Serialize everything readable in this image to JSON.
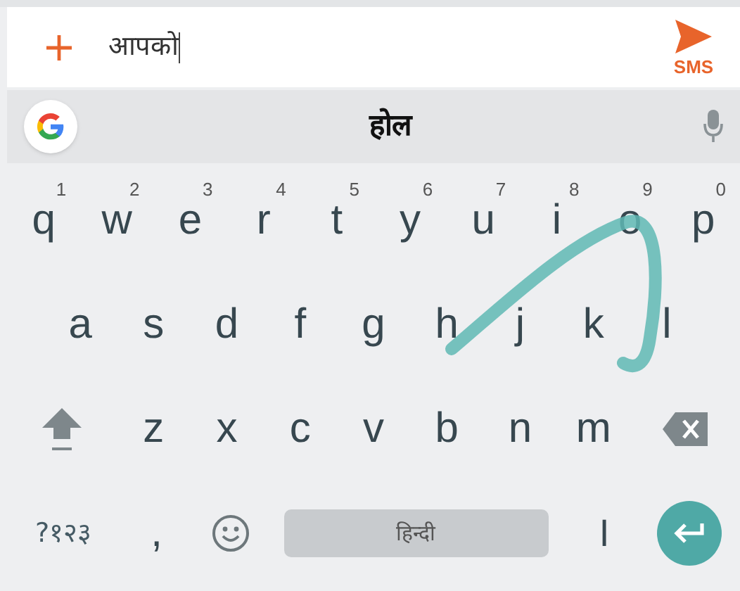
{
  "compose": {
    "value": "आपको",
    "send_label": "SMS"
  },
  "suggestion_bar": {
    "suggestion": "होल"
  },
  "keyboard": {
    "rows": [
      [
        {
          "kind": "letter",
          "label": "q",
          "hint": "1"
        },
        {
          "kind": "letter",
          "label": "w",
          "hint": "2"
        },
        {
          "kind": "letter",
          "label": "e",
          "hint": "3"
        },
        {
          "kind": "letter",
          "label": "r",
          "hint": "4"
        },
        {
          "kind": "letter",
          "label": "t",
          "hint": "5"
        },
        {
          "kind": "letter",
          "label": "y",
          "hint": "6"
        },
        {
          "kind": "letter",
          "label": "u",
          "hint": "7"
        },
        {
          "kind": "letter",
          "label": "i",
          "hint": "8"
        },
        {
          "kind": "letter",
          "label": "o",
          "hint": "9"
        },
        {
          "kind": "letter",
          "label": "p",
          "hint": "0"
        }
      ],
      [
        {
          "kind": "letter",
          "label": "a"
        },
        {
          "kind": "letter",
          "label": "s"
        },
        {
          "kind": "letter",
          "label": "d"
        },
        {
          "kind": "letter",
          "label": "f"
        },
        {
          "kind": "letter",
          "label": "g"
        },
        {
          "kind": "letter",
          "label": "h"
        },
        {
          "kind": "letter",
          "label": "j"
        },
        {
          "kind": "letter",
          "label": "k"
        },
        {
          "kind": "letter",
          "label": "l"
        }
      ],
      [
        {
          "kind": "shift"
        },
        {
          "kind": "letter",
          "label": "z"
        },
        {
          "kind": "letter",
          "label": "x"
        },
        {
          "kind": "letter",
          "label": "c"
        },
        {
          "kind": "letter",
          "label": "v"
        },
        {
          "kind": "letter",
          "label": "b"
        },
        {
          "kind": "letter",
          "label": "n"
        },
        {
          "kind": "letter",
          "label": "m"
        },
        {
          "kind": "backspace"
        }
      ],
      [
        {
          "kind": "symbols",
          "label": "?१२३"
        },
        {
          "kind": "letter",
          "label": ","
        },
        {
          "kind": "emoji"
        },
        {
          "kind": "space",
          "label": "हिन्दी"
        },
        {
          "kind": "letter",
          "label": "।"
        },
        {
          "kind": "enter"
        }
      ]
    ]
  }
}
